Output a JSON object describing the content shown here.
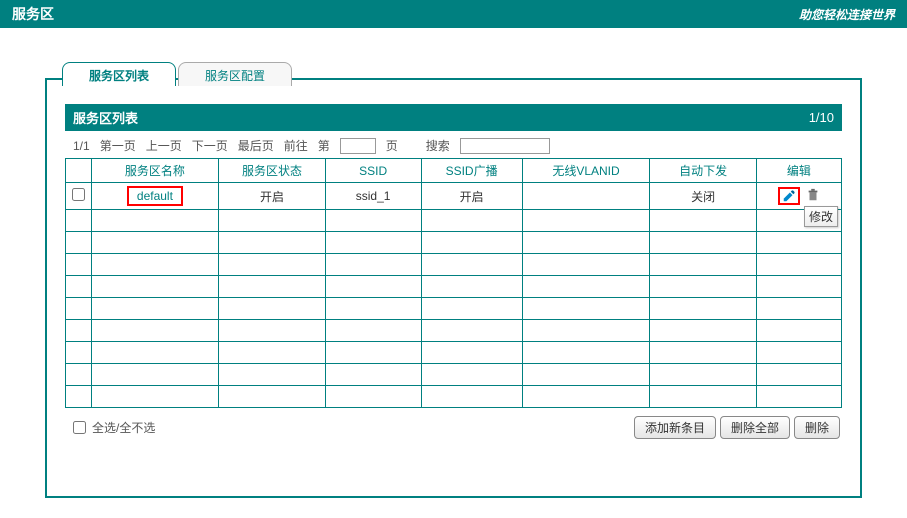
{
  "header": {
    "title": "服务区",
    "tagline": "助您轻松连接世界"
  },
  "tabs": {
    "active": "服务区列表",
    "inactive": "服务区配置"
  },
  "section": {
    "title": "服务区列表",
    "page_info": "1/10"
  },
  "pagination": {
    "counter": "1/1",
    "first": "第一页",
    "prev": "上一页",
    "next": "下一页",
    "last": "最后页",
    "go": "前往",
    "page_prefix": "第",
    "page_suffix": "页",
    "search": "搜索"
  },
  "columns": {
    "name": "服务区名称",
    "status": "服务区状态",
    "ssid": "SSID",
    "broadcast": "SSID广播",
    "vlan": "无线VLANID",
    "auto": "自动下发",
    "edit": "编辑"
  },
  "rows": [
    {
      "name": "default",
      "status": "开启",
      "ssid": "ssid_1",
      "broadcast": "开启",
      "vlan": "",
      "auto": "关闭"
    }
  ],
  "tooltip": {
    "edit": "修改"
  },
  "footer": {
    "select_all": "全选/全不选",
    "add": "添加新条目",
    "delete_all": "删除全部",
    "delete": "删除"
  }
}
